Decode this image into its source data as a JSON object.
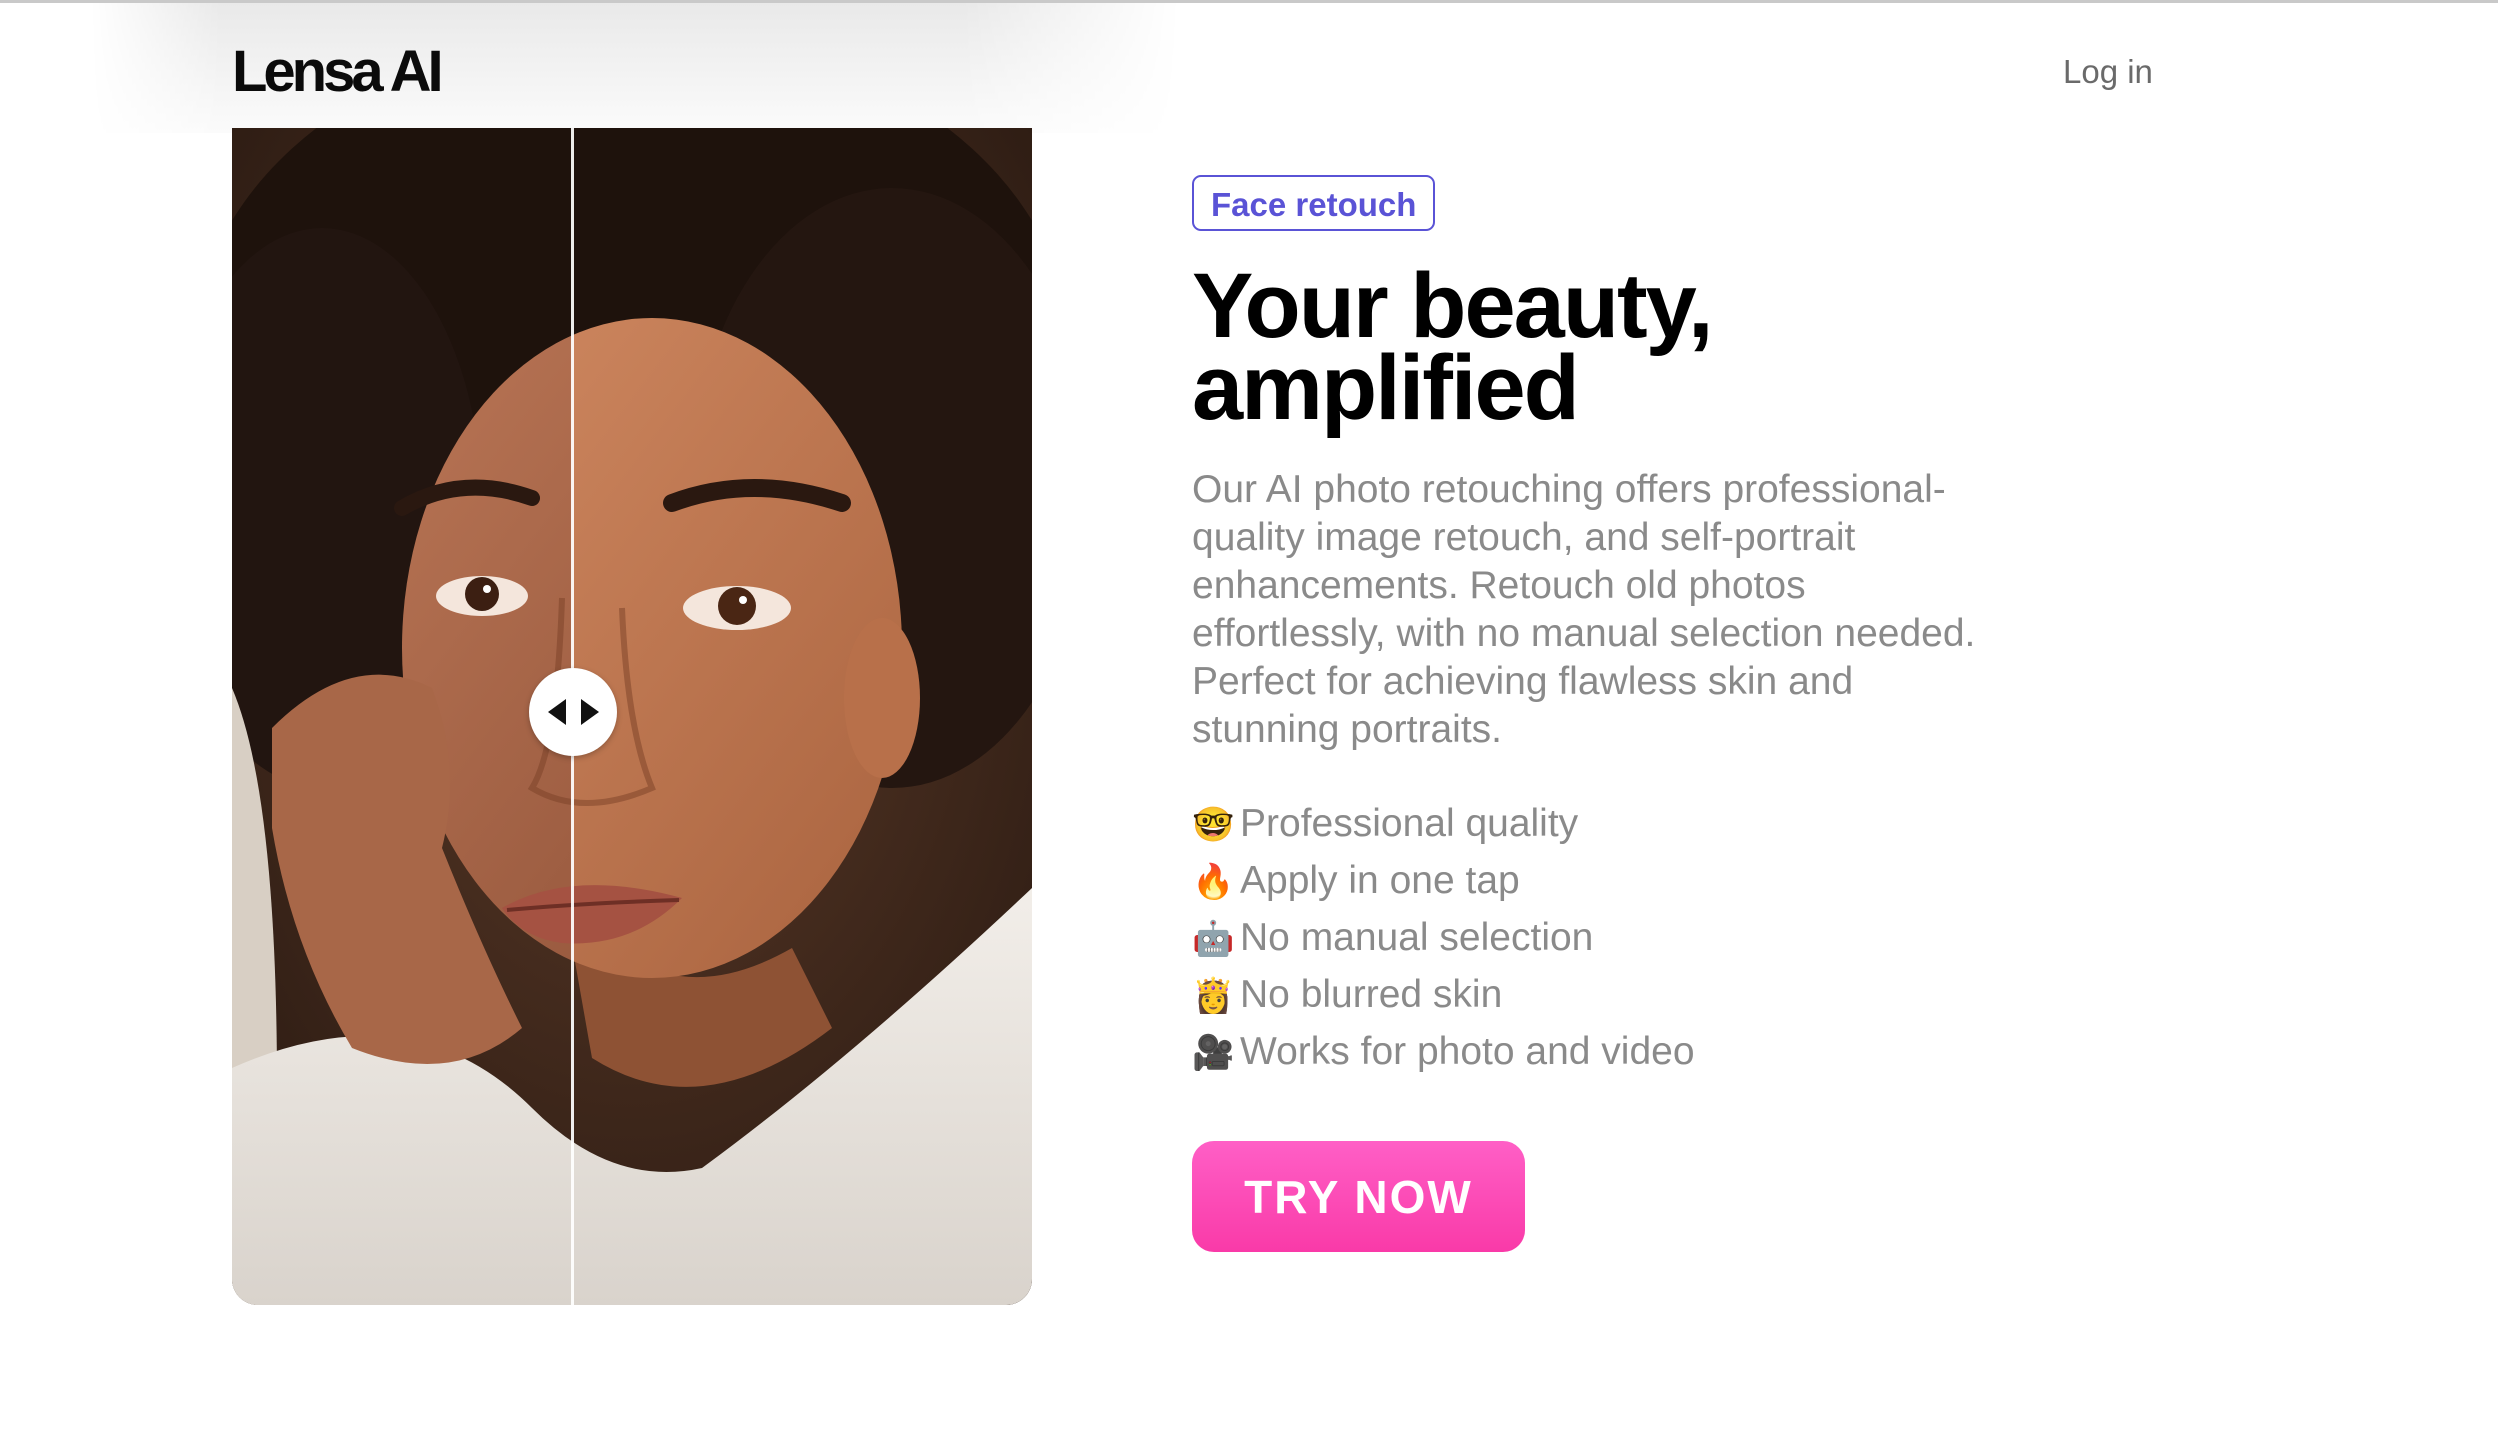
{
  "header": {
    "logo": "Lensa AI",
    "login_label": "Log in"
  },
  "compare": {
    "image_description_icon": "before-after-portrait",
    "handle_icon": "left-right-arrows-icon"
  },
  "hero": {
    "badge": "Face retouch",
    "headline": "Your beauty, amplified",
    "description": "Our AI photo retouching offers professional-quality image retouch, and self-portrait enhancements. Retouch old photos effortlessly, with no manual selection needed. Perfect for achieving flawless skin and stunning portraits.",
    "features": [
      {
        "emoji": "🤓",
        "text": "Professional quality"
      },
      {
        "emoji": "🔥",
        "text": "Apply in one tap"
      },
      {
        "emoji": "🤖",
        "text": "No manual selection"
      },
      {
        "emoji": "👸",
        "text": "No blurred skin"
      },
      {
        "emoji": "🎥",
        "text": "Works for photo and video"
      }
    ],
    "cta_label": "TRY NOW"
  },
  "colors": {
    "badge_accent": "#5a53d6",
    "cta_pink": "#f93aa8",
    "body_text": "#8a8a8a",
    "heading": "#000000"
  }
}
